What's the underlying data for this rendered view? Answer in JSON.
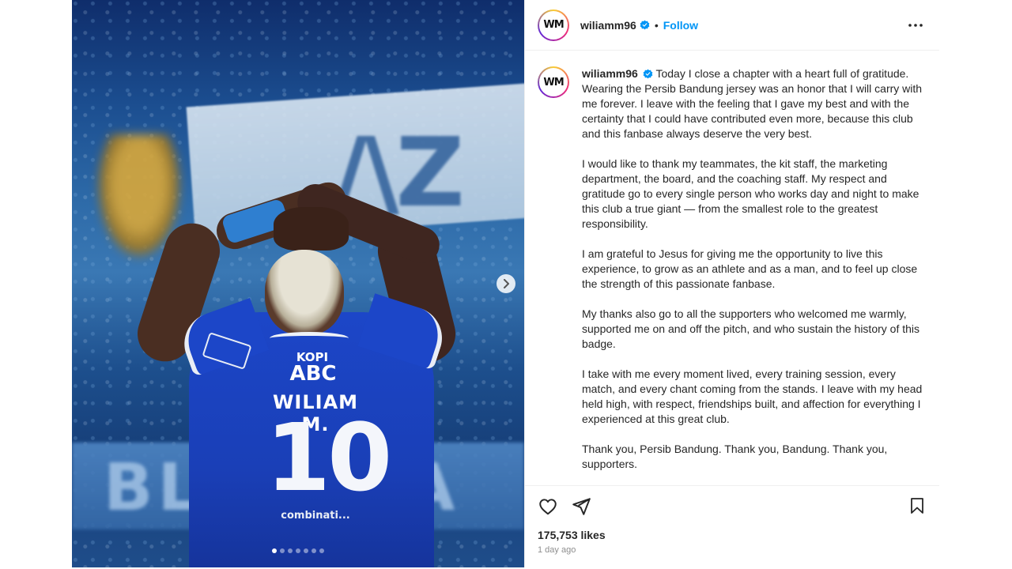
{
  "post": {
    "username": "wiliamm96",
    "avatar_initials": "WM",
    "separator": "•",
    "follow_label": "Follow",
    "caption_paragraphs": [
      "Today I close a chapter with a heart full of gratitude. Wearing the Persib Bandung jersey was an honor that I will carry with me forever. I leave with the feeling that I gave my best and with the certainty that I could have contributed even more, because this club and this fanbase always deserve the very best.",
      "I would like to thank my teammates, the kit staff, the marketing department, the board, and the coaching staff. My respect and gratitude go to every single person who works day and night to make this club a true giant — from the smallest role to the greatest responsibility.",
      "I am grateful to Jesus for giving me the opportunity to live this experience, to grow as an athlete and as a man, and to feel up close the strength of this passionate fanbase.",
      "My thanks also go to all the supporters who welcomed me warmly, supported me on and off the pitch, and who sustain the history of this badge.",
      "I take with me every moment lived, every training session, every match, and every chant coming from the stands. I leave with my head held high, with respect, friendships built, and affection for everything I experienced at this great club.",
      "Thank you, Persib Bandung. Thank you, Bandung. Thank you, supporters."
    ],
    "likes": "175,753 likes",
    "timestamp": "1 day ago"
  },
  "media": {
    "carousel_count": 7,
    "active_index": 0,
    "jersey": {
      "sponsor_top": "KOPI",
      "sponsor_main": "ABC",
      "name": "WILIAM M.",
      "number": "10",
      "sponsor_bottom": "combinati..."
    }
  },
  "icons": {
    "more": "more-options-icon",
    "next": "chevron-right-icon",
    "like": "heart-icon",
    "share": "paper-plane-icon",
    "save": "bookmark-icon",
    "verified": "verified-badge-icon"
  },
  "colors": {
    "link": "#0095f6",
    "verified": "#0095f6",
    "text": "#262626",
    "muted": "#8e8e8e",
    "jersey": "#1c46c8"
  }
}
